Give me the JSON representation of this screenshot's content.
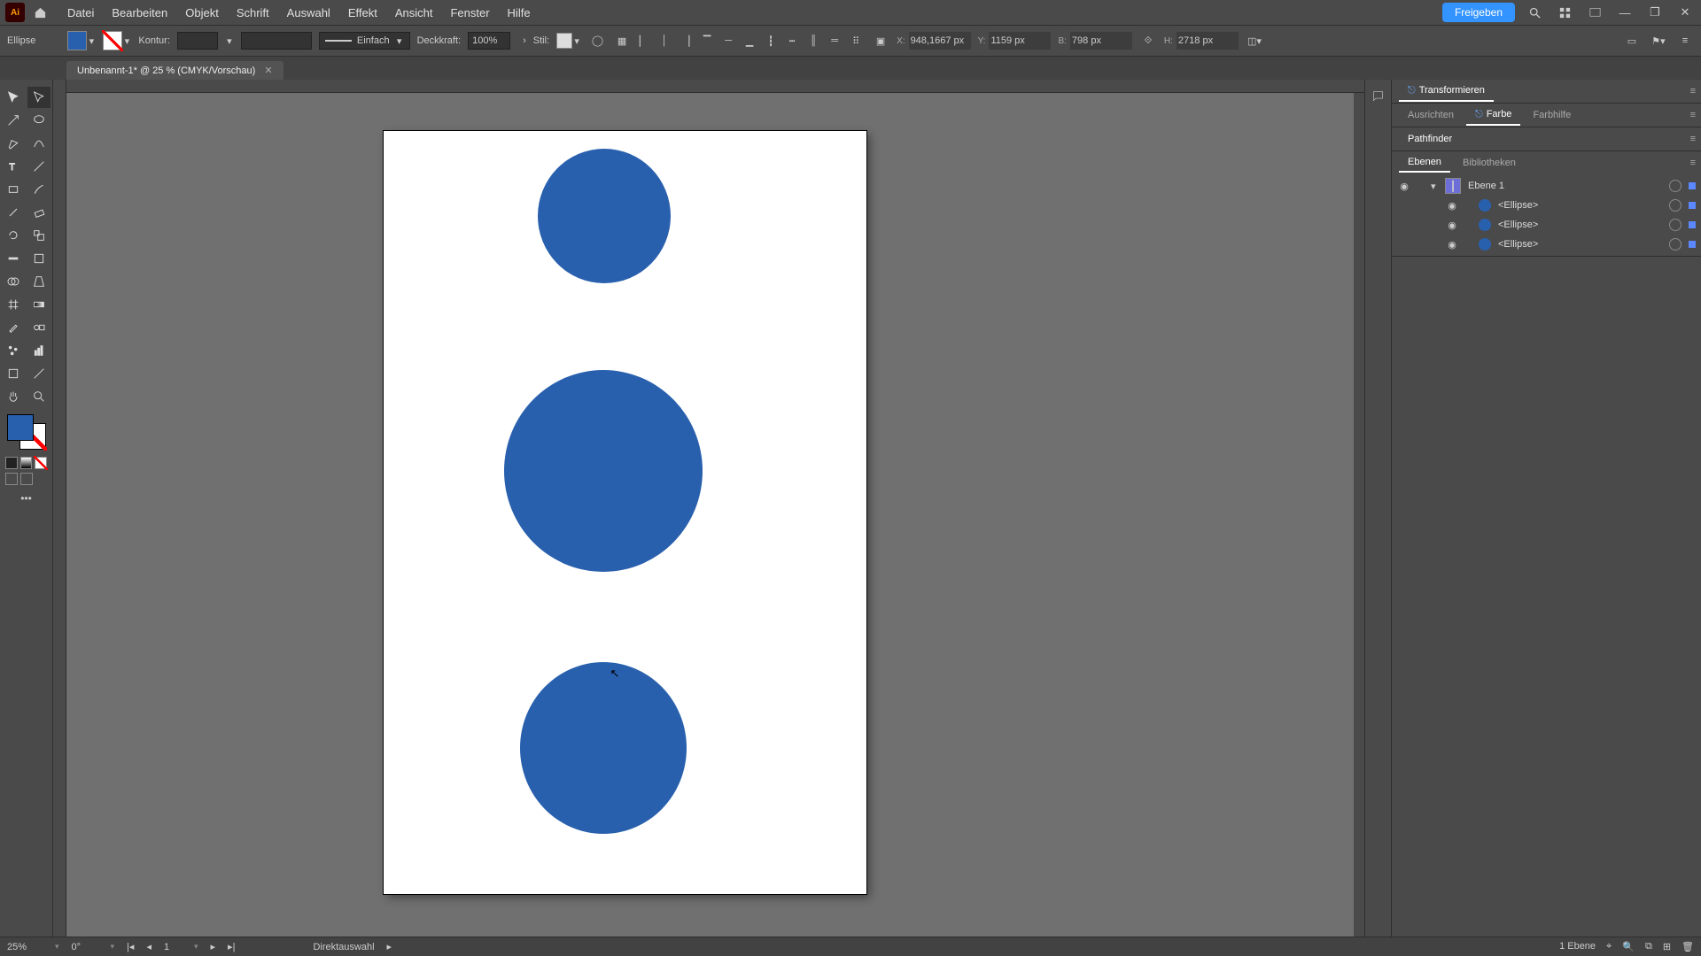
{
  "menu": {
    "items": [
      "Datei",
      "Bearbeiten",
      "Objekt",
      "Schrift",
      "Auswahl",
      "Effekt",
      "Ansicht",
      "Fenster",
      "Hilfe"
    ]
  },
  "share_btn": "Freigeben",
  "controlbar": {
    "object": "Ellipse",
    "kontur_label": "Kontur:",
    "kontur_value": "",
    "brush_style": "Einfach",
    "opacity_label": "Deckkraft:",
    "opacity_value": "100%",
    "style_label": "Stil:",
    "x_label": "X:",
    "x_value": "948,1667 px",
    "y_label": "Y:",
    "y_value": "1159 px",
    "w_label": "B:",
    "w_value": "798 px",
    "h_label": "H:",
    "h_value": "2718 px"
  },
  "fill_color": "#2960ad",
  "document": {
    "tab_title": "Unbenannt-1* @ 25 % (CMYK/Vorschau)"
  },
  "tools": [
    [
      "selection",
      "direct-selection"
    ],
    [
      "magic-wand",
      "lasso"
    ],
    [
      "pen",
      "curvature"
    ],
    [
      "type",
      "line"
    ],
    [
      "rectangle",
      "paintbrush"
    ],
    [
      "shaper",
      "eraser"
    ],
    [
      "rotate",
      "scale"
    ],
    [
      "width",
      "free-transform"
    ],
    [
      "shape-builder",
      "perspective"
    ],
    [
      "mesh",
      "gradient"
    ],
    [
      "eyedropper",
      "blend"
    ],
    [
      "symbol-sprayer",
      "graph"
    ],
    [
      "artboard",
      "slice"
    ],
    [
      "hand",
      "zoom"
    ]
  ],
  "panels": {
    "transform": "Transformieren",
    "align": "Ausrichten",
    "color": "Farbe",
    "guides": "Farbhilfe",
    "pathfinder": "Pathfinder",
    "layers": "Ebenen",
    "libraries": "Bibliotheken"
  },
  "layers": {
    "layer_name": "Ebene 1",
    "items": [
      "<Ellipse>",
      "<Ellipse>",
      "<Ellipse>"
    ]
  },
  "status": {
    "zoom": "25%",
    "rotate": "0°",
    "artboard": "1",
    "tool": "Direktauswahl",
    "layer_count": "1 Ebene"
  }
}
